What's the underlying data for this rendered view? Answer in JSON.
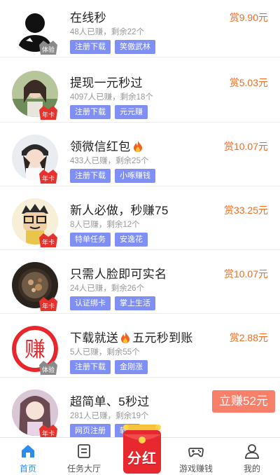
{
  "tasks": [
    {
      "title": "在线秒",
      "stats": "48人已赚，剩余22个",
      "tags": [
        "注册下载",
        "笑傲武林"
      ],
      "reward": "赏9.90元",
      "badge": "体验",
      "badge_color": "#8a8a8a",
      "avatar": "silhouette"
    },
    {
      "title": "提现一元秒过",
      "stats": "4097人已赚，剩余18个",
      "tags": [
        "注册下载",
        "元元赚"
      ],
      "reward": "赏5.03元",
      "badge": "年卡",
      "badge_color": "#e5322d",
      "avatar": "girl-green"
    },
    {
      "title": "领微信红包",
      "title_icon": "fire-icon",
      "stats": "433人已赚，剩余25个",
      "tags": [
        "注册下载",
        "小啄赚钱"
      ],
      "reward": "赏10.07元",
      "badge": "年卡",
      "badge_color": "#e5322d",
      "avatar": "girl-cap"
    },
    {
      "title": "新人必做，秒赚75",
      "stats": "8人已赚，剩余12个",
      "tags": [
        "特单任务",
        "安逸花"
      ],
      "reward": "赏33.25元",
      "badge": "年卡",
      "badge_color": "#e5322d",
      "avatar": "cartoon"
    },
    {
      "title": "只需人脸即可实名",
      "stats": "24人已赚，剩余26个",
      "tags": [
        "认证绑卡",
        "掌上生活"
      ],
      "reward": "赏10.07元",
      "badge": "年卡",
      "badge_color": "#e5322d",
      "avatar": "food"
    },
    {
      "title": "下载就送",
      "title_icon": "fire-icon",
      "title_suffix": "五元秒到账",
      "stats": "5人已赚，剩余55个",
      "tags": [
        "注册下载",
        "金刚涨"
      ],
      "reward": "赏2.88元",
      "badge": "体验",
      "badge_color": "#8a8a8a",
      "avatar": "zhuan"
    },
    {
      "title": "超简单、5秒过",
      "stats": "281人已赚，剩余19个",
      "tags": [
        "网页注册",
        "软件"
      ],
      "reward": "",
      "badge": "年卡",
      "badge_color": "#e5322d",
      "avatar": "girl-pink"
    }
  ],
  "claim_button": "立赚52元",
  "tabbar": {
    "home": "首页",
    "tasks": "任务大厅",
    "dividend": "分红",
    "games": "游戏赚钱",
    "me": "我的"
  },
  "avatar_glyph": "赚",
  "colors": {
    "accent": "#2a8cf0",
    "reward": "#f26b1d",
    "tag": "#7f8ff3",
    "claim": "#f8806a"
  }
}
